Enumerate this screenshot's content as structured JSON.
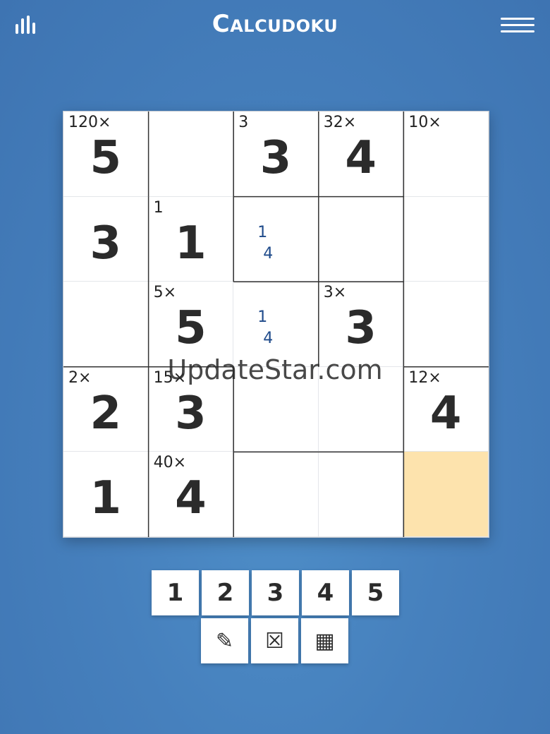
{
  "header": {
    "title": "Calcudoku",
    "left_icon": "stats-icon",
    "right_icon": "menu-icon"
  },
  "grid": {
    "size": 5,
    "selected_cell": [
      4,
      4
    ],
    "cells": [
      [
        {
          "cage": "120×",
          "value": "5"
        },
        {
          "cage": "",
          "value": ""
        },
        {
          "cage": "3",
          "value": "3"
        },
        {
          "cage": "32×",
          "value": "4"
        },
        {
          "cage": "10×",
          "value": ""
        }
      ],
      [
        {
          "cage": "",
          "value": "3"
        },
        {
          "cage": "1",
          "value": "1"
        },
        {
          "cage": "",
          "value": "",
          "notes": [
            "1",
            "4"
          ]
        },
        {
          "cage": "",
          "value": ""
        },
        {
          "cage": "",
          "value": ""
        }
      ],
      [
        {
          "cage": "",
          "value": ""
        },
        {
          "cage": "5×",
          "value": "5"
        },
        {
          "cage": "",
          "value": "",
          "notes": [
            "1",
            "4"
          ]
        },
        {
          "cage": "3×",
          "value": "3"
        },
        {
          "cage": "",
          "value": ""
        }
      ],
      [
        {
          "cage": "2×",
          "value": "2"
        },
        {
          "cage": "15×",
          "value": "3"
        },
        {
          "cage": "",
          "value": ""
        },
        {
          "cage": "",
          "value": ""
        },
        {
          "cage": "12×",
          "value": "4"
        }
      ],
      [
        {
          "cage": "",
          "value": "1"
        },
        {
          "cage": "40×",
          "value": "4"
        },
        {
          "cage": "",
          "value": ""
        },
        {
          "cage": "",
          "value": ""
        },
        {
          "cage": "",
          "value": ""
        }
      ]
    ]
  },
  "keypad": {
    "numbers": [
      "1",
      "2",
      "3",
      "4",
      "5"
    ],
    "tools": [
      {
        "name": "pencil-icon",
        "glyph": "✎"
      },
      {
        "name": "erase-icon",
        "glyph": "☒"
      },
      {
        "name": "calculator-icon",
        "glyph": "▦"
      }
    ]
  },
  "watermark": "UpdateStar.com",
  "colors": {
    "background": "#4680bd",
    "selected_cell": "#fde3ad",
    "note_text": "#1e4a8a"
  }
}
